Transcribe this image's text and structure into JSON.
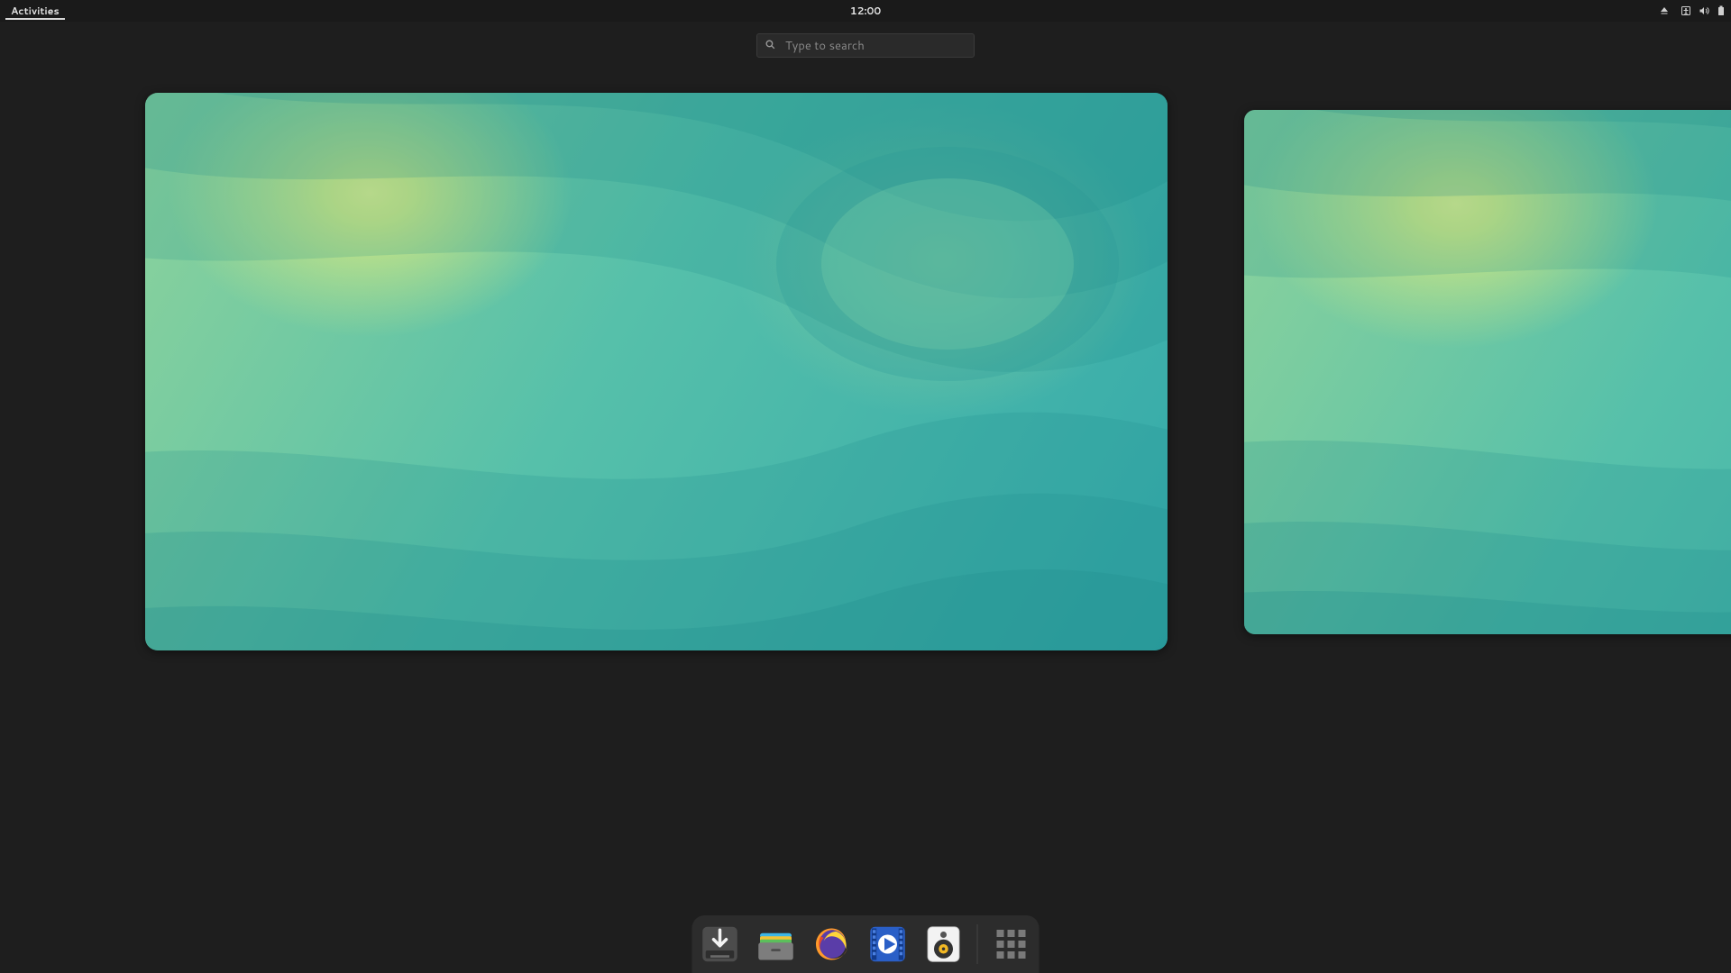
{
  "panel": {
    "activities_label": "Activities",
    "clock": "12:00"
  },
  "search": {
    "placeholder": "Type to search"
  },
  "dock": {
    "items": [
      {
        "name": "install-debian"
      },
      {
        "name": "files"
      },
      {
        "name": "firefox"
      },
      {
        "name": "media-player"
      },
      {
        "name": "rhythmbox"
      }
    ],
    "apps_grid_label": "Show Applications"
  }
}
